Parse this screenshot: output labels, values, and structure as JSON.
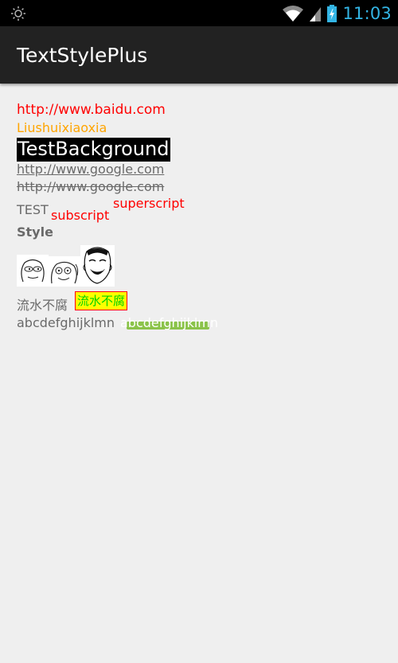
{
  "app": {
    "title": "TextStylePlus"
  },
  "status_bar": {
    "time": "11:03",
    "icons": [
      "brightness-icon",
      "wifi-icon",
      "signal-icon",
      "battery-charging-icon"
    ]
  },
  "content": {
    "url_red": "http://www.baidu.com",
    "orange_text": "Liushuixiaoxia",
    "background_text": "TestBackground",
    "underline_text": "http://www.google.com",
    "strike_text": "http://www.google.com",
    "base_text": "TEST",
    "subscript_text": "subscript",
    "superscript_text": "superscript",
    "bold_text": "Style",
    "chinese_plain": "流水不腐",
    "chinese_boxed": "流水不腐",
    "abc_plain": "abcdefghijklmn",
    "abc_highlight": "abcdefghijklmn"
  },
  "colors": {
    "status_time": "#33b5e5",
    "action_bar": "#222222",
    "content_bg": "#efefef",
    "red": "#ff0000",
    "orange": "#ffa500",
    "gray_text": "#6a6a6a",
    "yellow": "#ffff00",
    "green_text": "#00d000",
    "green_highlight": "#8bc34a"
  }
}
